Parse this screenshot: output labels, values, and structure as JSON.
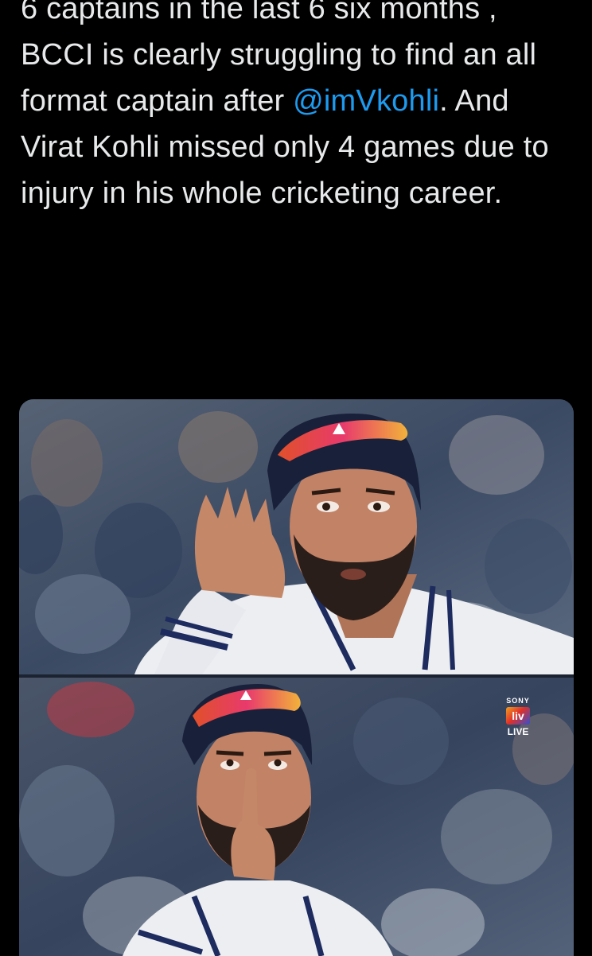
{
  "tweet": {
    "text_before_mention": "6 captains in the last 6 six months , BCCI is clearly struggling to find an all format captain after ",
    "mention": "@imVkohli",
    "text_after_mention": ". And Virat Kohli missed only 4 games due to injury in his whole cricketing career."
  },
  "media": {
    "broadcast_logo": {
      "brand": "SONY",
      "mark": "liv",
      "status": "LIVE"
    }
  },
  "colors": {
    "background": "#000000",
    "text": "#e7e9ea",
    "mention": "#1d9bf0"
  }
}
